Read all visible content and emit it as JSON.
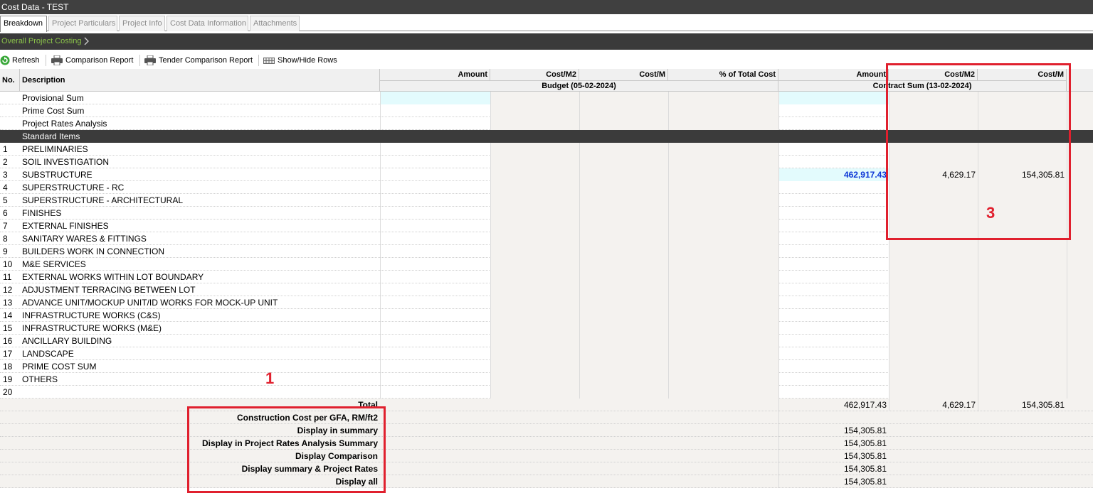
{
  "window": {
    "title": "Cost Data - TEST"
  },
  "tabs": [
    {
      "label": "Breakdown",
      "active": true
    },
    {
      "label": "Project Particulars",
      "active": false
    },
    {
      "label": "Project Info",
      "active": false
    },
    {
      "label": "Cost Data Information",
      "active": false
    },
    {
      "label": "Attachments",
      "active": false
    }
  ],
  "breadcrumb": {
    "label": "Overall Project Costing"
  },
  "toolbar": {
    "refresh": "Refresh",
    "comparison_report": "Comparison Report",
    "tender_comparison_report": "Tender Comparison Report",
    "show_hide_rows": "Show/Hide Rows"
  },
  "table": {
    "headers": {
      "no": "No.",
      "description": "Description",
      "budget_amount": "Amount",
      "budget_cost_m2": "Cost/M2",
      "budget_cost_m": "Cost/M",
      "pct_total": "% of Total Cost",
      "contract_amount": "Amount",
      "contract_cost_m2": "Cost/M2",
      "contract_cost_m": "Cost/M",
      "budget_group": "Budget (05-02-2024)",
      "contract_group": "Contract Sum (13-02-2024)"
    },
    "special_rows": [
      "Provisional Sum",
      "Prime Cost Sum",
      "Project Rates Analysis"
    ],
    "section_title": "Standard Items",
    "items": [
      {
        "no": "1",
        "desc": "PRELIMINARIES",
        "c_amount": "",
        "c_m2": "",
        "c_m": ""
      },
      {
        "no": "2",
        "desc": "SOIL INVESTIGATION",
        "c_amount": "",
        "c_m2": "",
        "c_m": ""
      },
      {
        "no": "3",
        "desc": "SUBSTRUCTURE",
        "c_amount": "462,917.43",
        "c_m2": "4,629.17",
        "c_m": "154,305.81"
      },
      {
        "no": "4",
        "desc": "SUPERSTRUCTURE - RC",
        "c_amount": "",
        "c_m2": "",
        "c_m": ""
      },
      {
        "no": "5",
        "desc": "SUPERSTRUCTURE - ARCHITECTURAL",
        "c_amount": "",
        "c_m2": "",
        "c_m": ""
      },
      {
        "no": "6",
        "desc": "FINISHES",
        "c_amount": "",
        "c_m2": "",
        "c_m": ""
      },
      {
        "no": "7",
        "desc": "EXTERNAL FINISHES",
        "c_amount": "",
        "c_m2": "",
        "c_m": ""
      },
      {
        "no": "8",
        "desc": "SANITARY WARES & FITTINGS",
        "c_amount": "",
        "c_m2": "",
        "c_m": ""
      },
      {
        "no": "9",
        "desc": "BUILDERS WORK IN CONNECTION",
        "c_amount": "",
        "c_m2": "",
        "c_m": ""
      },
      {
        "no": "10",
        "desc": "M&E SERVICES",
        "c_amount": "",
        "c_m2": "",
        "c_m": ""
      },
      {
        "no": "11",
        "desc": "EXTERNAL WORKS WITHIN LOT BOUNDARY",
        "c_amount": "",
        "c_m2": "",
        "c_m": ""
      },
      {
        "no": "12",
        "desc": "ADJUSTMENT TERRACING BETWEEN LOT",
        "c_amount": "",
        "c_m2": "",
        "c_m": ""
      },
      {
        "no": "13",
        "desc": "ADVANCE UNIT/MOCKUP UNIT/ID WORKS FOR MOCK-UP UNIT",
        "c_amount": "",
        "c_m2": "",
        "c_m": ""
      },
      {
        "no": "14",
        "desc": "INFRASTRUCTURE WORKS (C&S)",
        "c_amount": "",
        "c_m2": "",
        "c_m": ""
      },
      {
        "no": "15",
        "desc": "INFRASTRUCTURE WORKS (M&E)",
        "c_amount": "",
        "c_m2": "",
        "c_m": ""
      },
      {
        "no": "16",
        "desc": "ANCILLARY BUILDING",
        "c_amount": "",
        "c_m2": "",
        "c_m": ""
      },
      {
        "no": "17",
        "desc": "LANDSCAPE",
        "c_amount": "",
        "c_m2": "",
        "c_m": ""
      },
      {
        "no": "18",
        "desc": "PRIME COST SUM",
        "c_amount": "",
        "c_m2": "",
        "c_m": ""
      },
      {
        "no": "19",
        "desc": "OTHERS",
        "c_amount": "",
        "c_m2": "",
        "c_m": ""
      },
      {
        "no": "20",
        "desc": "",
        "c_amount": "",
        "c_m2": "",
        "c_m": ""
      }
    ],
    "total": {
      "label": "Total",
      "c_amount": "462,917.43",
      "c_m2": "4,629.17",
      "c_m": "154,305.81"
    },
    "summary_rows": [
      {
        "label": "Construction Cost per GFA, RM/ft2",
        "value": ""
      },
      {
        "label": "Display in summary",
        "value": "154,305.81"
      },
      {
        "label": "Display in Project Rates Analysis Summary",
        "value": "154,305.81"
      },
      {
        "label": "Display Comparison",
        "value": "154,305.81"
      },
      {
        "label": "Display summary & Project Rates",
        "value": "154,305.81"
      },
      {
        "label": "Display all",
        "value": "154,305.81"
      }
    ]
  },
  "annotations": {
    "marker_1": "1",
    "marker_3": "3"
  }
}
